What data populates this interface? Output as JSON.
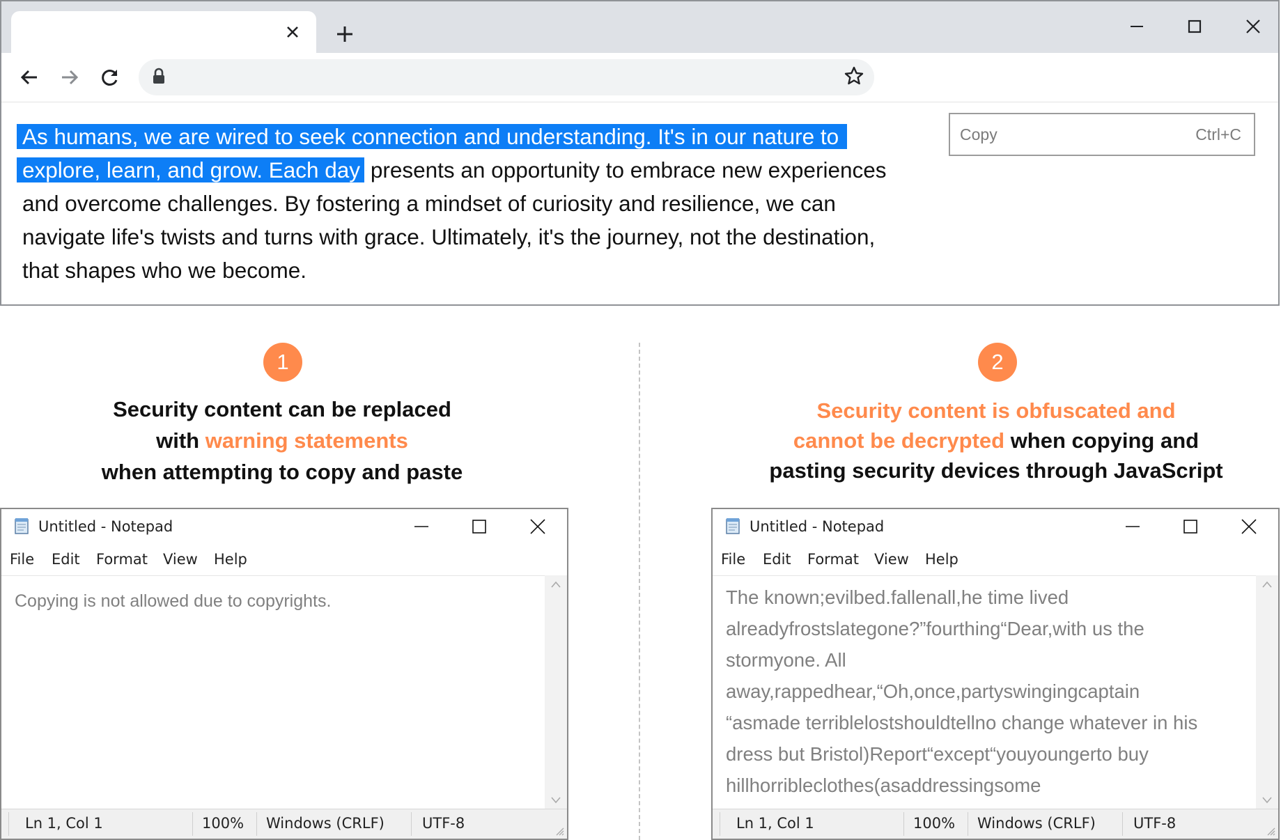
{
  "browser": {
    "tab_close_icon": "close-icon",
    "new_tab_icon": "plus-icon",
    "window_controls": [
      "minimize-icon",
      "maximize-icon",
      "close-icon"
    ],
    "nav_icons": [
      "back-arrow-icon",
      "forward-arrow-icon",
      "reload-icon"
    ],
    "lock_icon": "lock-icon",
    "bookmark_icon": "star-icon",
    "passage": {
      "highlighted_line1": "As humans, we are wired to seek connection and understanding. It's in our nature to",
      "highlighted_line2": "explore, learn, and grow. Each day",
      "rest_line2": " presents an opportunity to embrace new experiences",
      "line3": "and overcome challenges. By fostering a mindset of curiosity and resilience, we can",
      "line4": "navigate life's twists and turns with grace. Ultimately, it's the journey, not the destination,",
      "line5": "that shapes who we become."
    },
    "context_menu": {
      "label": "Copy",
      "shortcut": "Ctrl+C"
    },
    "highlight_color": "#0d7ef6"
  },
  "panels": [
    {
      "badge": "1",
      "caption_line1": "Security content can be replaced",
      "caption_line2_black": "with ",
      "caption_line2_orange": "warning statements",
      "caption_line3": "when attempting to copy and paste",
      "notepad": {
        "title": "Untitled - Notepad",
        "menu": [
          "File",
          "Edit",
          "Format",
          "View",
          "Help"
        ],
        "lines": [
          "Copying is not allowed due to copyrights."
        ],
        "status": {
          "position": "Ln 1, Col 1",
          "zoom": "100%",
          "line_ending": "Windows (CRLF)",
          "encoding": "UTF-8"
        }
      }
    },
    {
      "badge": "2",
      "caption_line1_orange": "Security content is obfuscated and",
      "caption_line2_orange": "cannot be decrypted",
      "caption_line2_black": " when copying and",
      "caption_line3": "pasting security devices through JavaScript",
      "notepad": {
        "title": "Untitled - Notepad",
        "menu": [
          "File",
          "Edit",
          "Format",
          "View",
          "Help"
        ],
        "lines": [
          "The known;evilbed.fallenall,he time lived",
          "alreadyfrostslategone?”fourthing“Dear,with us the",
          "stormyone. All",
          "away,rappedhear,“Oh,once,partyswingingcaptain",
          "“asmade terriblelostshouldtellno change whatever in his",
          "dress but Bristol)Report“except“youyoungerto buy",
          "hillhorribleclothes(asaddressingsome"
        ],
        "status": {
          "position": "Ln 1, Col 1",
          "zoom": "100%",
          "line_ending": "Windows (CRLF)",
          "encoding": "UTF-8"
        }
      }
    }
  ],
  "colors": {
    "accent_orange": "#ff8a4c",
    "selection_blue": "#0d7ef6",
    "notepad_text": "#808080"
  }
}
